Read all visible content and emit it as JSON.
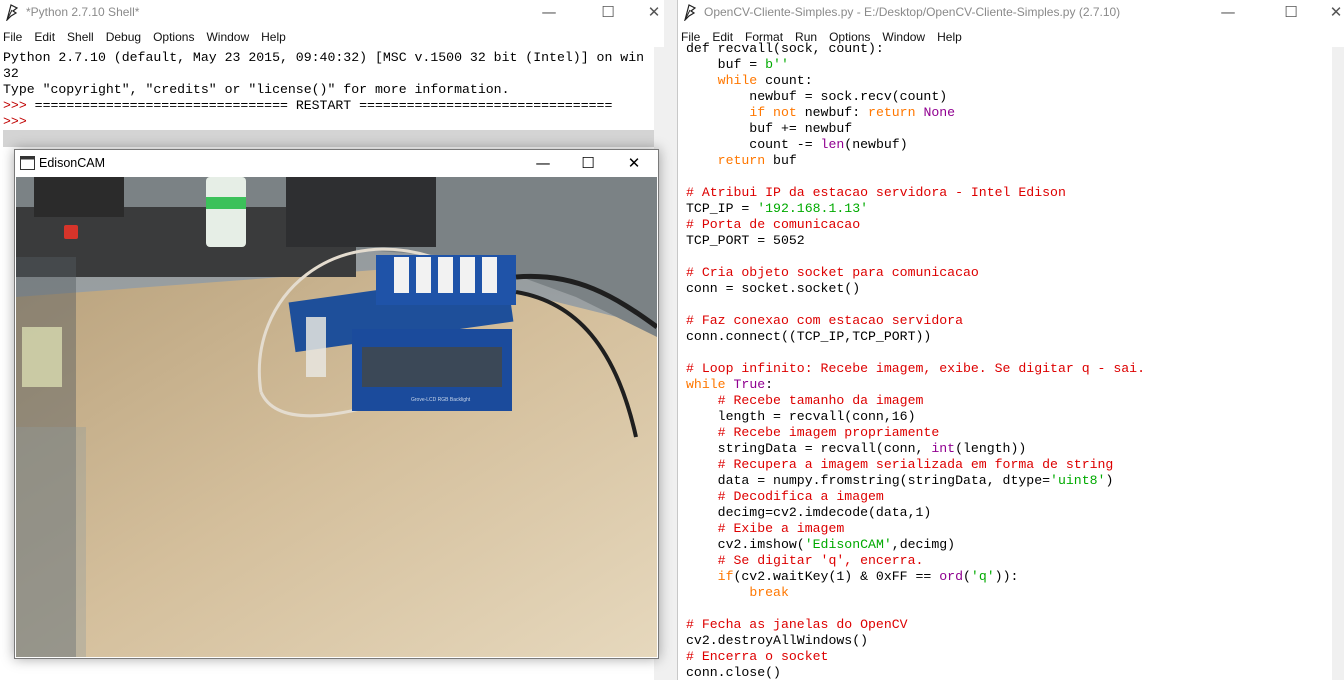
{
  "shell": {
    "title": "*Python 2.7.10 Shell*",
    "menu": [
      "File",
      "Edit",
      "Shell",
      "Debug",
      "Options",
      "Window",
      "Help"
    ],
    "banner_1": "Python 2.7.10 (default, May 23 2015, 09:40:32) [MSC v.1500 32 bit (Intel)] on win",
    "banner_2": "32",
    "banner_3": "Type \"copyright\", \"credits\" or \"license()\" for more information.",
    "prompt": ">>>",
    "restart_line": " ================================ RESTART ================================"
  },
  "editor": {
    "title": "OpenCV-Cliente-Simples.py - E:/Desktop/OpenCV-Cliente-Simples.py (2.7.10)",
    "menu": [
      "File",
      "Edit",
      "Format",
      "Run",
      "Options",
      "Window",
      "Help"
    ],
    "code_lines": [
      [
        [
          "def recvall(sock, count):",
          ""
        ]
      ],
      [
        [
          "    buf = ",
          ""
        ],
        [
          "b''",
          "st"
        ]
      ],
      [
        [
          "    ",
          ""
        ],
        [
          "while",
          "kw"
        ],
        [
          " count:",
          ""
        ]
      ],
      [
        [
          "        newbuf = sock.recv(count)",
          ""
        ]
      ],
      [
        [
          "        ",
          ""
        ],
        [
          "if not",
          "kw"
        ],
        [
          " newbuf: ",
          ""
        ],
        [
          "return",
          "kw"
        ],
        [
          " ",
          ""
        ],
        [
          "None",
          "bi"
        ]
      ],
      [
        [
          "        buf += newbuf",
          ""
        ]
      ],
      [
        [
          "        count -= ",
          ""
        ],
        [
          "len",
          "bi"
        ],
        [
          "(newbuf)",
          ""
        ]
      ],
      [
        [
          "    ",
          ""
        ],
        [
          "return",
          "kw"
        ],
        [
          " buf",
          ""
        ]
      ],
      [],
      [
        [
          "# Atribui IP da estacao servidora - Intel Edison",
          "cm"
        ]
      ],
      [
        [
          "TCP_IP = ",
          ""
        ],
        [
          "'192.168.1.13'",
          "st"
        ]
      ],
      [
        [
          "# Porta de comunicacao",
          "cm"
        ]
      ],
      [
        [
          "TCP_PORT = 5052",
          ""
        ]
      ],
      [],
      [
        [
          "# Cria objeto socket para comunicacao",
          "cm"
        ]
      ],
      [
        [
          "conn = socket.socket()",
          ""
        ]
      ],
      [],
      [
        [
          "# Faz conexao com estacao servidora",
          "cm"
        ]
      ],
      [
        [
          "conn.connect((TCP_IP,TCP_PORT))",
          ""
        ]
      ],
      [],
      [
        [
          "# Loop infinito: Recebe imagem, exibe. Se digitar q - sai.",
          "cm"
        ]
      ],
      [
        [
          "while",
          "kw"
        ],
        [
          " ",
          ""
        ],
        [
          "True",
          "bi"
        ],
        [
          ":",
          ""
        ]
      ],
      [
        [
          "    ",
          ""
        ],
        [
          "# Recebe tamanho da imagem",
          "cm"
        ]
      ],
      [
        [
          "    length = recvall(conn,16)",
          ""
        ]
      ],
      [
        [
          "    ",
          ""
        ],
        [
          "# Recebe imagem propriamente",
          "cm"
        ]
      ],
      [
        [
          "    stringData = recvall(conn, ",
          ""
        ],
        [
          "int",
          "bi"
        ],
        [
          "(length))",
          ""
        ]
      ],
      [
        [
          "    ",
          ""
        ],
        [
          "# Recupera a imagem serializada em forma de string",
          "cm"
        ]
      ],
      [
        [
          "    data = numpy.fromstring(stringData, dtype=",
          ""
        ],
        [
          "'uint8'",
          "st"
        ],
        [
          ")",
          ""
        ]
      ],
      [
        [
          "    ",
          ""
        ],
        [
          "# Decodifica a imagem",
          "cm"
        ]
      ],
      [
        [
          "    decimg=cv2.imdecode(data,1)",
          ""
        ]
      ],
      [
        [
          "    ",
          ""
        ],
        [
          "# Exibe a imagem",
          "cm"
        ]
      ],
      [
        [
          "    cv2.imshow(",
          ""
        ],
        [
          "'EdisonCAM'",
          "st"
        ],
        [
          ",decimg)",
          ""
        ]
      ],
      [
        [
          "    ",
          ""
        ],
        [
          "# Se digitar 'q', encerra.",
          "cm"
        ]
      ],
      [
        [
          "    ",
          ""
        ],
        [
          "if",
          "kw"
        ],
        [
          "(cv2.waitKey(1) & 0xFF == ",
          ""
        ],
        [
          "ord",
          "bi"
        ],
        [
          "(",
          ""
        ],
        [
          "'q'",
          "st"
        ],
        [
          ")):",
          ""
        ]
      ],
      [
        [
          "        ",
          ""
        ],
        [
          "break",
          "kw"
        ]
      ],
      [],
      [
        [
          "# Fecha as janelas do OpenCV",
          "cm"
        ]
      ],
      [
        [
          "cv2.destroyAllWindows()",
          ""
        ]
      ],
      [
        [
          "# Encerra o socket",
          "cm"
        ]
      ],
      [
        [
          "conn.close()",
          ""
        ]
      ]
    ]
  },
  "cam": {
    "title": "EdisonCAM",
    "board_label": "Grove-LCD RGB Backlight"
  },
  "window_controls": {
    "minimize": "—",
    "maximize": "☐",
    "close": "✕"
  },
  "colors": {
    "keyword": "#ff7700",
    "comment": "#dd0000",
    "string": "#00aa00",
    "builtin": "#900090",
    "prompt": "#c00000"
  }
}
